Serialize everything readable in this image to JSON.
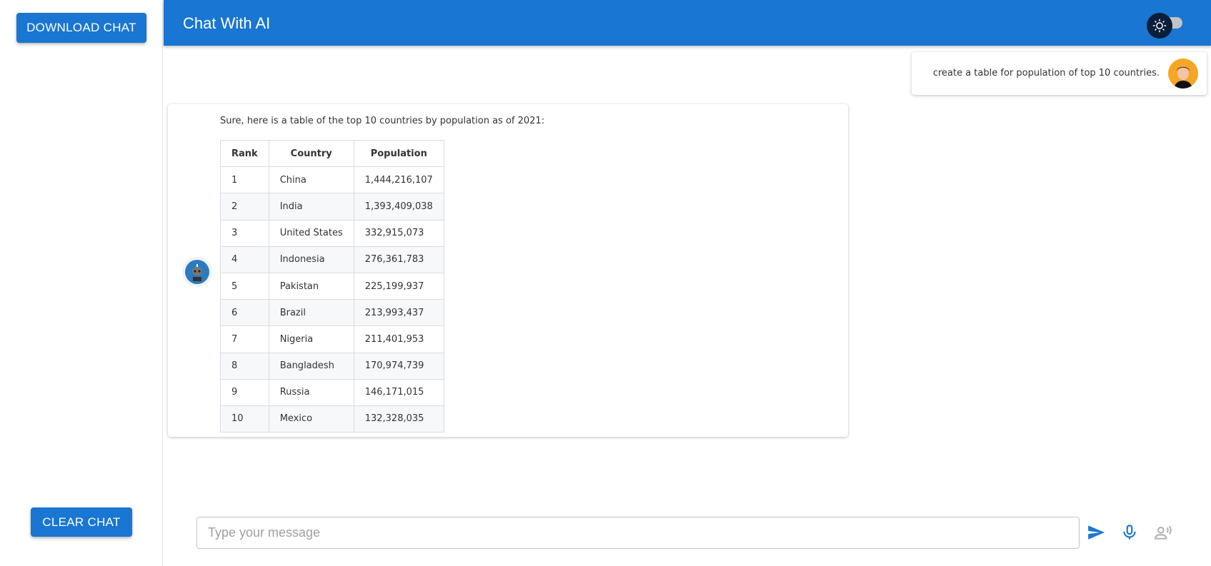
{
  "sidebar": {
    "download_label": "DOWNLOAD CHAT",
    "clear_label": "CLEAR CHAT"
  },
  "header": {
    "title": "Chat With AI",
    "theme_toggle": "light",
    "colors": {
      "primary": "#1976d2"
    }
  },
  "messages": {
    "user": {
      "text": "create a table for population of top 10 countries."
    },
    "bot": {
      "intro": "Sure, here is a table of the top 10 countries by population as of 2021:",
      "table": {
        "headers": [
          "Rank",
          "Country",
          "Population"
        ],
        "rows": [
          [
            "1",
            "China",
            "1,444,216,107"
          ],
          [
            "2",
            "India",
            "1,393,409,038"
          ],
          [
            "3",
            "United States",
            "332,915,073"
          ],
          [
            "4",
            "Indonesia",
            "276,361,783"
          ],
          [
            "5",
            "Pakistan",
            "225,199,937"
          ],
          [
            "6",
            "Brazil",
            "213,993,437"
          ],
          [
            "7",
            "Nigeria",
            "211,401,953"
          ],
          [
            "8",
            "Bangladesh",
            "170,974,739"
          ],
          [
            "9",
            "Russia",
            "146,171,015"
          ],
          [
            "10",
            "Mexico",
            "132,328,035"
          ]
        ]
      }
    }
  },
  "composer": {
    "placeholder": "Type your message",
    "value": "",
    "icons": [
      "send-icon",
      "microphone-icon",
      "voice-chat-icon"
    ]
  }
}
